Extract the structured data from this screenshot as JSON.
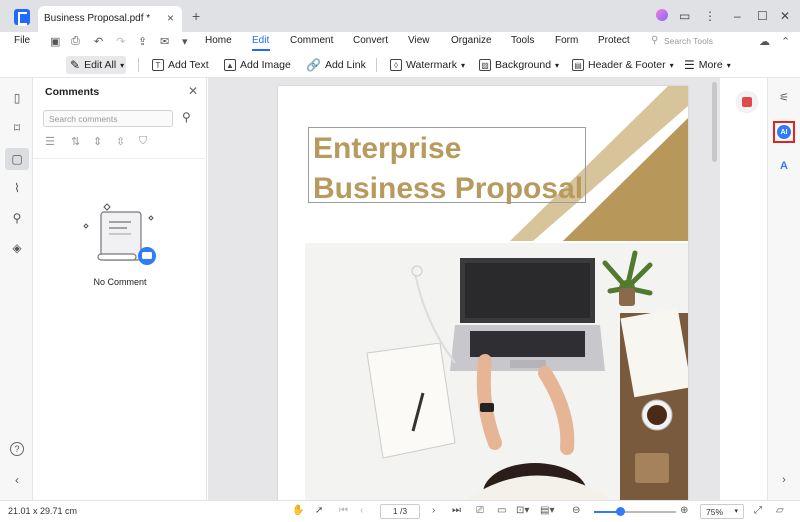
{
  "tab": {
    "title": "Business Proposal.pdf *",
    "close": "×",
    "new_tab": "+"
  },
  "window_controls": {
    "minimize": "–",
    "maximize": "☐",
    "close": "✕"
  },
  "menu": {
    "file": "File",
    "items": [
      "Home",
      "Edit",
      "Comment",
      "Convert",
      "View",
      "Organize",
      "Tools",
      "Form",
      "Protect"
    ],
    "active": "Edit",
    "search_placeholder": "Search Tools"
  },
  "toolbar": {
    "edit_all": "Edit All",
    "add_text": "Add Text",
    "add_image": "Add Image",
    "add_link": "Add Link",
    "watermark": "Watermark",
    "background": "Background",
    "header_footer": "Header & Footer",
    "more": "More"
  },
  "comments_panel": {
    "title": "Comments",
    "search_placeholder": "Search comments",
    "empty_text": "No Comment"
  },
  "document": {
    "title_line1": "Enterprise",
    "title_line2": "Business Proposal",
    "title_color": "#b79a5e",
    "accent_color": "#b7975a",
    "light_accent": "#d8c49a"
  },
  "right_rail": {
    "ai_label": "AI"
  },
  "status": {
    "page_size": "21.01 x 29.71 cm",
    "page_indicator": "1 /3",
    "zoom": "75%"
  },
  "colors": {
    "brand": "#1f6bff",
    "ai_highlight": "#e02424"
  }
}
